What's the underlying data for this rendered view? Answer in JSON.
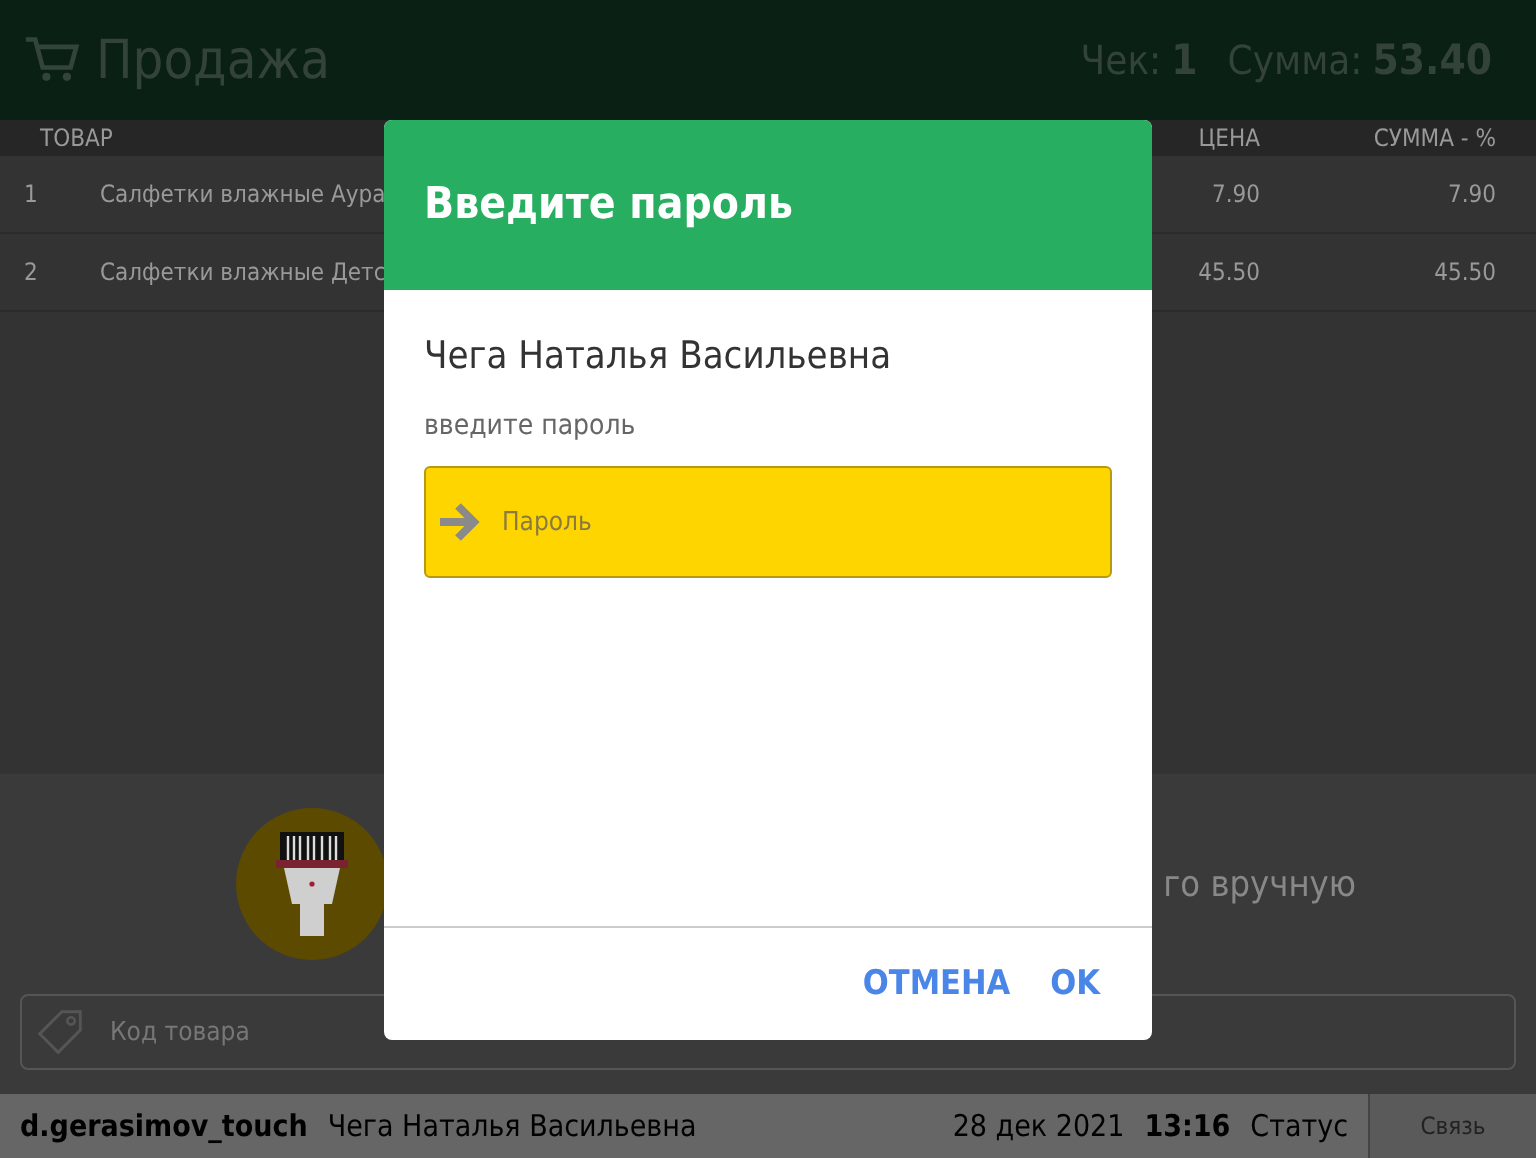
{
  "header": {
    "title": "Продажа",
    "receipt_label": "Чек:",
    "receipt_number": "1",
    "sum_label": "Сумма:",
    "sum_value": "53.40"
  },
  "table": {
    "columns": [
      "ТОВАР",
      "ЦЕНА",
      "СУММА - %"
    ],
    "rows": [
      {
        "number": "1",
        "name": "Салфетки влажные Аура",
        "price": "7.90",
        "sum": "7.90"
      },
      {
        "number": "2",
        "name": "Салфетки влажные Детс",
        "price": "45.50",
        "sum": "45.50"
      }
    ]
  },
  "scan_hint": "го вручную",
  "code_field": {
    "placeholder": "Код товара"
  },
  "status_bar": {
    "login": "d.gerasimov_touch",
    "user": "Чега Наталья Васильевна",
    "date": "28 дек 2021",
    "time": "13:16",
    "status": "Статус",
    "connection": "Связь"
  },
  "dialog": {
    "title": "Введите пароль",
    "user": "Чега Наталья Васильевна",
    "prompt": "введите пароль",
    "password_field": {
      "placeholder": "Пароль"
    },
    "buttons": [
      "ОТМЕНА",
      "OK"
    ]
  }
}
